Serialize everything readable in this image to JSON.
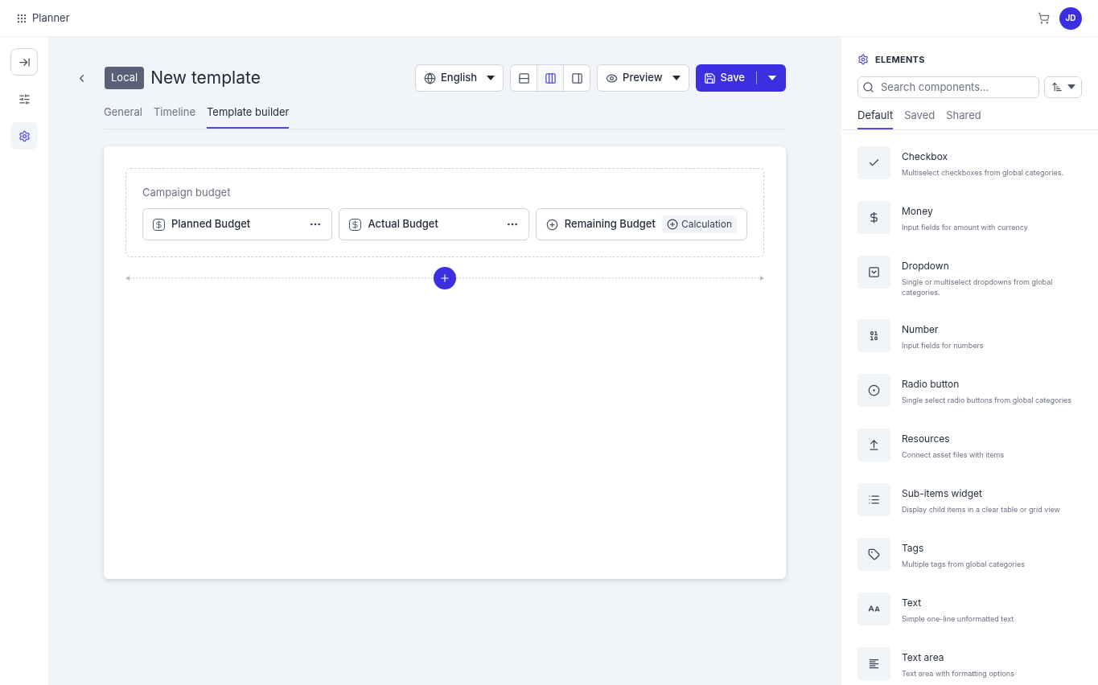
{
  "app": {
    "name": "Planner",
    "avatar": "JD"
  },
  "rail": [
    {
      "kind": "collapse",
      "selected": false
    },
    {
      "kind": "sliders",
      "selected": false
    },
    {
      "kind": "settings",
      "selected": true
    }
  ],
  "header": {
    "badge": "Local",
    "title": "New template",
    "language": "English",
    "preview": "Preview",
    "save": "Save"
  },
  "view_toggles": [
    {
      "kind": "rows",
      "selected": false
    },
    {
      "kind": "columns",
      "selected": true
    },
    {
      "kind": "sidebar",
      "selected": false
    }
  ],
  "tabs": [
    {
      "label": "General",
      "selected": false
    },
    {
      "label": "Timeline",
      "selected": false
    },
    {
      "label": "Template builder",
      "selected": true
    }
  ],
  "section": {
    "title": "Campaign budget",
    "fields": [
      {
        "kind": "money",
        "label": "Planned Budget"
      },
      {
        "kind": "money",
        "label": "Actual Budget"
      },
      {
        "kind": "calculation",
        "label": "Remaining Budget",
        "badge": "Calculation"
      }
    ]
  },
  "panel": {
    "title": "ELEMENTS",
    "search": {
      "placeholder": "Search components..."
    },
    "tabs": [
      {
        "label": "Default",
        "selected": true
      },
      {
        "label": "Saved",
        "selected": false
      },
      {
        "label": "Shared",
        "selected": false
      }
    ],
    "items": [
      {
        "kind": "checkbox",
        "name": "Checkbox",
        "description": "Multiselect checkboxes from global categories."
      },
      {
        "kind": "money",
        "name": "Money",
        "description": "Input fields for amount with currency"
      },
      {
        "kind": "dropdown",
        "name": "Dropdown",
        "description": "Single or multiselect dropdowns from global categories."
      },
      {
        "kind": "number",
        "name": "Number",
        "description": "Input fields for numbers"
      },
      {
        "kind": "radio",
        "name": "Radio button",
        "description": "Single select radio buttons from global categories"
      },
      {
        "kind": "upload",
        "name": "Resources",
        "description": "Connect asset files with items"
      },
      {
        "kind": "list",
        "name": "Sub-items widget",
        "description": "Display child items in a clear table or grid view"
      },
      {
        "kind": "tag",
        "name": "Tags",
        "description": "Multiple tags from global categories"
      },
      {
        "kind": "text",
        "name": "Text",
        "description": "Simple one-line unformatted text"
      },
      {
        "kind": "textarea",
        "name": "Text area",
        "description": "Text area with formatting options"
      }
    ]
  }
}
